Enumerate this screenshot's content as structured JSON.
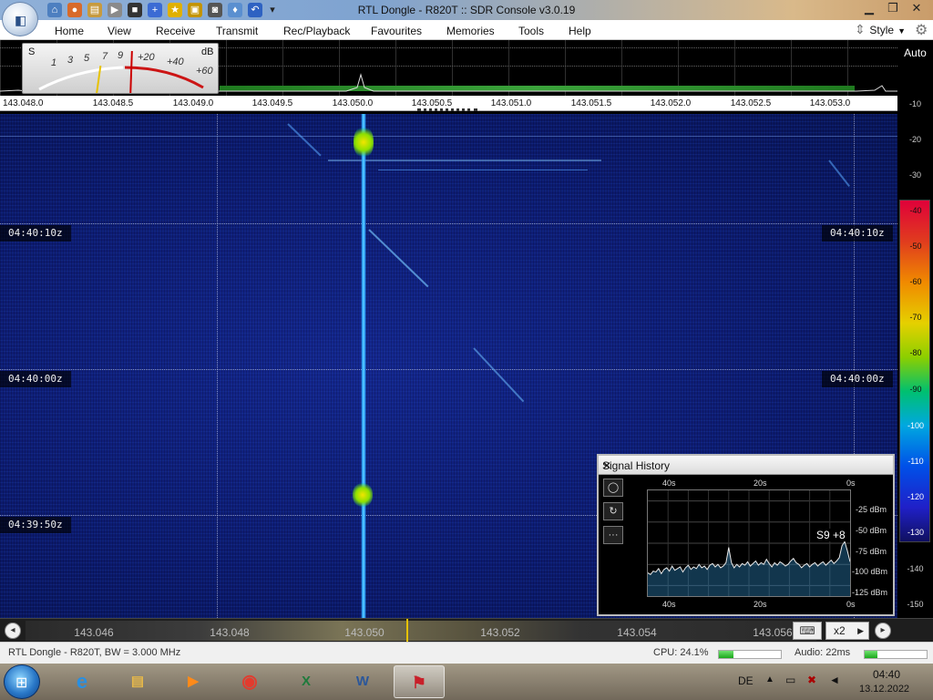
{
  "window": {
    "title": "RTL Dongle - R820T :: SDR Console v3.0.19"
  },
  "menu": {
    "items": [
      "Home",
      "View",
      "Receive",
      "Transmit",
      "Rec/Playback",
      "Favourites",
      "Memories",
      "Tools",
      "Help"
    ],
    "style_label": "Style"
  },
  "smeter": {
    "s_label": "S",
    "db_label": "dB",
    "s_ticks": [
      "1",
      "3",
      "5",
      "7",
      "9"
    ],
    "plus_ticks": [
      "+20",
      "+40",
      "+60"
    ]
  },
  "spectrum": {
    "auto_label": "Auto",
    "freq_labels": [
      "143.048.0",
      "143.048.5",
      "143.049.0",
      "143.049.5",
      "143.050.0",
      "143.050.5",
      "143.051.0",
      "143.051.5",
      "143.052.0",
      "143.052.5",
      "143.053.0"
    ]
  },
  "db_scale": {
    "labels": [
      "-10",
      "-20",
      "-30",
      "-40",
      "-50",
      "-60",
      "-70",
      "-80",
      "-90",
      "-100",
      "-110",
      "-120",
      "-130",
      "-140",
      "-150"
    ]
  },
  "waterfall": {
    "timestamps": [
      "04:40:10z",
      "04:40:00z",
      "04:39:50z"
    ]
  },
  "signal_history": {
    "title": "Signal History",
    "time_top": [
      "40s",
      "20s",
      "0s"
    ],
    "time_bottom": [
      "40s",
      "20s",
      "0s"
    ],
    "db_labels": [
      "-25 dBm",
      "-50 dBm",
      "-75 dBm",
      "-100 dBm",
      "-125 dBm"
    ],
    "level_label": "S9 +8",
    "trace_dbm": [
      -110,
      -112,
      -108,
      -109,
      -105,
      -111,
      -106,
      -104,
      -108,
      -102,
      -107,
      -105,
      -103,
      -109,
      -104,
      -101,
      -106,
      -103,
      -105,
      -100,
      -104,
      -102,
      -106,
      -101,
      -99,
      -103,
      -100,
      -104,
      -102,
      -98,
      -80,
      -98,
      -104,
      -100,
      -103,
      -99,
      -101,
      -97,
      -102,
      -99,
      -96,
      -101,
      -98,
      -100,
      -94,
      -99,
      -103,
      -98,
      -101,
      -97,
      -99,
      -102,
      -100,
      -96,
      -93,
      -98,
      -100,
      -104,
      -101,
      -99,
      -103,
      -100,
      -98,
      -102,
      -99,
      -97,
      -101,
      -98,
      -95,
      -99,
      -96,
      -92,
      -78,
      -73,
      -84,
      -97
    ]
  },
  "bottom_nav": {
    "freq_labels": [
      "143.046",
      "143.048",
      "143.050",
      "143.052",
      "143.054",
      "143.056"
    ],
    "zoom_label": "x2"
  },
  "status": {
    "device": "RTL Dongle - R820T, BW = 3.000 MHz",
    "cpu": "CPU: 24.1%",
    "cpu_fraction": 0.241,
    "audio": "Audio: 22ms",
    "audio_fraction": 0.2
  },
  "taskbar": {
    "language": "DE",
    "time": "04:40",
    "date": "13.12.2022"
  }
}
